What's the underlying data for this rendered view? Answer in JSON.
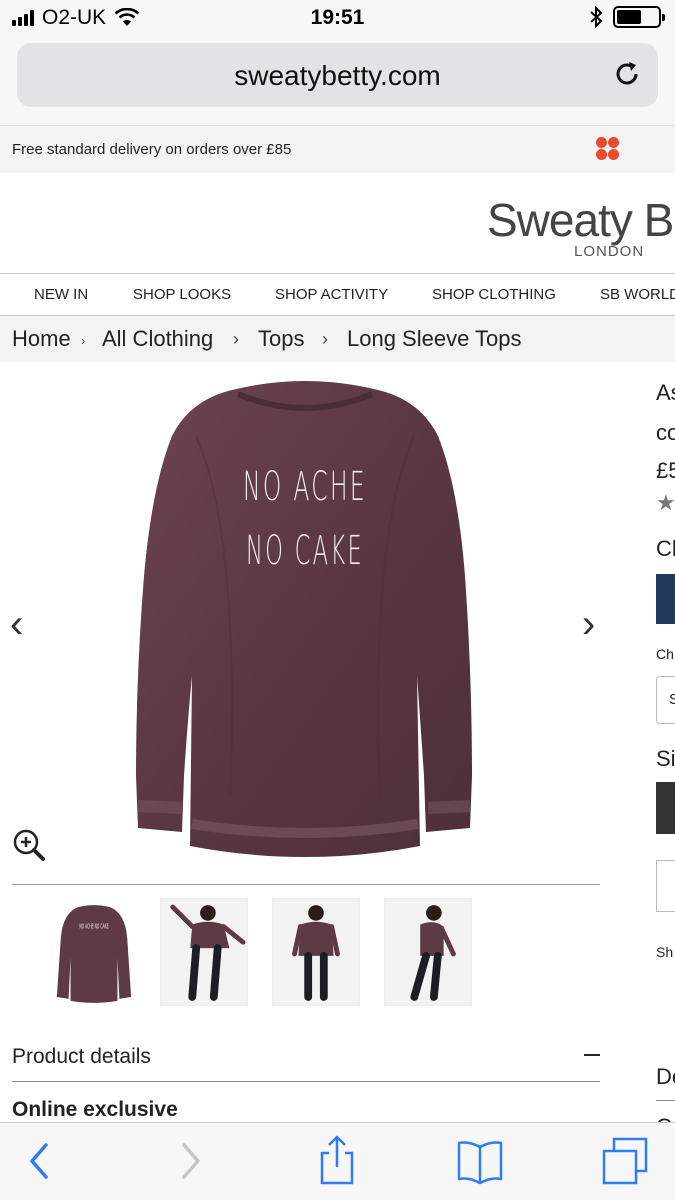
{
  "status_bar": {
    "carrier": "O2-UK",
    "time": "19:51"
  },
  "browser": {
    "url": "sweatybetty.com"
  },
  "promo": {
    "text": "Free standard delivery on orders over £85"
  },
  "header": {
    "brand": "Sweaty Be",
    "brand_sub": "LONDON"
  },
  "nav": {
    "items": [
      "NEW IN",
      "SHOP LOOKS",
      "SHOP ACTIVITY",
      "SHOP CLOTHING",
      "SB WORLD"
    ]
  },
  "breadcrumb": {
    "items": [
      "Home",
      "All Clothing",
      "Tops",
      "Long Sleeve Tops"
    ],
    "separator": "›"
  },
  "product": {
    "print_line1": "NO ACHE",
    "print_line2": "NO CAKE",
    "prev_arrow": "‹",
    "next_arrow": "›",
    "thumb_print": "NO ACHE NO CAKE",
    "details_label": "Product details",
    "exclusive_label": "Online exclusive"
  },
  "right_panel": {
    "title_1": "As",
    "title_2": "co",
    "price": "£5",
    "rating_star": "★",
    "colour_label": "Cl",
    "colour_sub": "Ch",
    "select_letter": "S",
    "size_label": "Si",
    "shipping": "Sh",
    "delivery": "De",
    "more": "C"
  },
  "colors": {
    "accent": "#1f3a5c",
    "garment": "#5e3a45",
    "promo_logo": "#ea4b2a",
    "ios_blue": "#2f7cf6"
  }
}
